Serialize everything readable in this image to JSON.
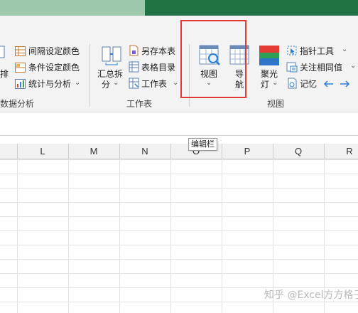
{
  "ribbon": {
    "left_partial": {
      "btn_partial_label": "排",
      "items": [
        {
          "label": "间隔设定颜色"
        },
        {
          "label": "条件设定颜色"
        },
        {
          "label": "统计与分析"
        }
      ],
      "group_label": "数据分析"
    },
    "worksheet_group": {
      "summarize_split": {
        "line1": "汇总拆",
        "line2": "分"
      },
      "items": [
        {
          "label": "另存本表"
        },
        {
          "label": "表格目录"
        },
        {
          "label": "工作表"
        }
      ],
      "group_label": "工作表"
    },
    "view_group": {
      "view_button": {
        "label": "视图"
      },
      "nav_button": {
        "line1": "导",
        "line2": "航"
      },
      "spotlight_button": {
        "line1": "聚光",
        "line2": "灯"
      },
      "items": [
        {
          "label": "指针工具"
        },
        {
          "label": "关注相同值"
        },
        {
          "label": "记忆"
        }
      ],
      "group_label": "视图"
    }
  },
  "tooltip": "编辑栏",
  "columns": [
    "L",
    "M",
    "N",
    "O",
    "P",
    "Q",
    "R"
  ],
  "watermark": "知乎 @Excel方方格子",
  "colors": {
    "excel_green": "#217346",
    "highlight_red": "#e03a33",
    "arrow_blue": "#2a7fd4"
  }
}
